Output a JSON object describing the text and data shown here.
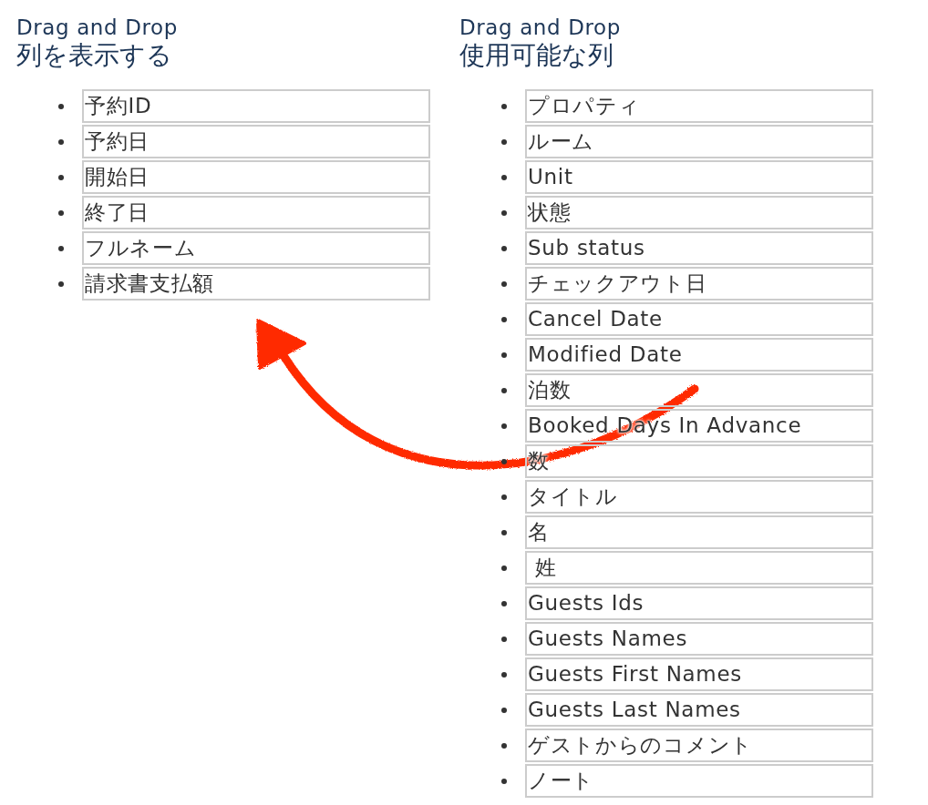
{
  "panels": [
    {
      "label": "Drag and Drop",
      "title": "列を表示する",
      "items": [
        "予約ID",
        "予約日",
        "開始日",
        "終了日",
        "フルネーム",
        "請求書支払額"
      ]
    },
    {
      "label": "Drag and Drop",
      "title": "使用可能な列",
      "items": [
        "プロパティ",
        "ルーム",
        "Unit",
        "状態",
        "Sub status",
        "チェックアウト日",
        "Cancel Date",
        "Modified Date",
        "泊数",
        "Booked Days In Advance",
        "数",
        "タイトル",
        "名",
        " 姓",
        "Guests Ids",
        "Guests Names",
        "Guests First Names",
        "Guests Last Names",
        "ゲストからのコメント",
        "ノート"
      ]
    }
  ]
}
